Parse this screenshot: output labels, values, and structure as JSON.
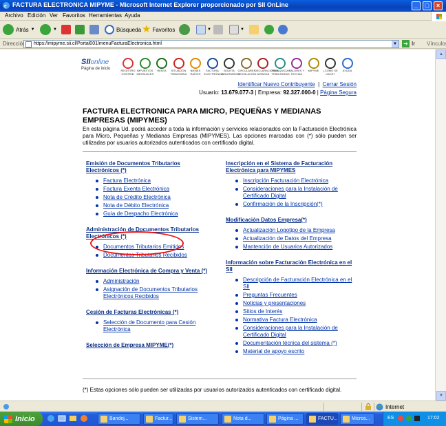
{
  "window": {
    "title": "FACTURA ELECTRONICA MIPYME - Microsoft Internet Explorer proporcionado por SII OnLine"
  },
  "menu": [
    "Archivo",
    "Edición",
    "Ver",
    "Favoritos",
    "Herramientas",
    "Ayuda"
  ],
  "toolbar": {
    "back": "Atrás",
    "search": "Búsqueda",
    "favorites": "Favoritos"
  },
  "address": {
    "label": "Dirección",
    "url": "https://mipyme.sii.cl/Portal001/menuFacturaElectronica.html",
    "go": "Ir",
    "links": "Vínculos"
  },
  "banner": {
    "logo_main": "SII",
    "logo_sub": "online",
    "logo_caption": "Página de inicio",
    "icons": [
      {
        "name": "registro-contribuyentes-icon",
        "label": "REGISTRO CONTRIB.",
        "color": "#d33"
      },
      {
        "name": "impuestos-mensuales-icon",
        "label": "IMPUESTOS MENSUALES",
        "color": "#2a8a2a"
      },
      {
        "name": "renta-icon",
        "label": "RENTA",
        "color": "#1a6a1a"
      },
      {
        "name": "situacion-tributaria-icon",
        "label": "SITUACIÓN TRIBUTARIA",
        "color": "#c22"
      },
      {
        "name": "bienes-raices-icon",
        "label": "BIENES RAÍCES",
        "color": "#e08a00"
      },
      {
        "name": "factura-electronica-icon",
        "label": "FACTURA ELECTRÓNICA",
        "color": "#1a4a9a"
      },
      {
        "name": "boleta-honorarios-icon",
        "label": "BOLETA HONORARIOS",
        "color": "#333"
      },
      {
        "name": "circulares-legislacion-icon",
        "label": "CIRCULARES LEGISLACIÓN",
        "color": "#8a6a2a"
      },
      {
        "name": "declaraciones-juradas-icon",
        "label": "DECLARACIONES JURADAS",
        "color": "#a22"
      },
      {
        "name": "franquicias-tributarias-icon",
        "label": "FRANQUICIAS TRIBUTARIAS",
        "color": "#2a8a8a"
      },
      {
        "name": "valores-y-fechas-icon",
        "label": "VALORES Y FECHAS",
        "color": "#9a2aa0"
      },
      {
        "name": "mipyme-icon",
        "label": "MIPYME",
        "color": "#b08a00"
      },
      {
        "name": "como-se-hace-icon",
        "label": "¿CÓMO SE HACE?",
        "color": "#333"
      },
      {
        "name": "ayuda-icon",
        "label": "AYUDA",
        "color": "#2a6ad0"
      }
    ]
  },
  "toplinks": {
    "identify": "Identificar Nuevo Contribuyente",
    "logout": "Cerrar Sesión",
    "usuario_label": "Usuario:",
    "usuario": "13.679.077-3",
    "empresa_label": "| Empresa:",
    "empresa": "92.327.000-0",
    "secure": "Página Segura"
  },
  "page": {
    "title": "FACTURA ELECTRONICA PARA MICRO, PEQUEÑAS Y MEDIANAS EMPRESAS (MIPYMES)",
    "intro": "En esta página Ud. podrá acceder a toda la información y servicios relacionados con la Facturación Electrónica para Micro, Pequeñas y Medianas Empresas (MIPYMES). Las opciones marcadas con (*) sólo pueden ser utilizadas por usuarios autorizados autenticados con certificado digital.",
    "footnote": "(*) Estas opciones sólo pueden ser utilizadas por usuarios autorizados autenticados con certificado digital."
  },
  "left_sections": [
    {
      "title": "Emisión de Documentos Tributarios Electrónicos (*)",
      "items": [
        "Factura Electrónica",
        "Factura Exenta Electrónica",
        "Nota de Crédito Electrónica",
        "Nota de Débito Electrónica",
        "Guía de Despacho Electrónica"
      ]
    },
    {
      "title": "Administración de Documentos Tributarios Electrónicos (*)",
      "items": [
        "Documentos Tributarios Emitidos",
        "Documentos Tributarios Recibidos"
      ]
    },
    {
      "title": "Información Electrónica de Compra y Venta (*)",
      "items": [
        "Administración",
        "Asignación de Documentos Tributarios Electrónicos Recibidos"
      ]
    },
    {
      "title": "Cesión de Facturas Electrónicas (*)",
      "items": [
        "Selección de Documento para Cesión Electrónica"
      ]
    },
    {
      "title": "Selección de Empresa MIPYME(*)",
      "items": []
    }
  ],
  "right_sections": [
    {
      "title": "Inscripción en el Sistema de Facturación Electrónica para MIPYMES",
      "items": [
        "Inscripción Facturación Electrónica",
        "Consideraciones para la Instalación de Certificado Digital",
        "Confirmación de la Inscripción(*)"
      ]
    },
    {
      "title": "Modificación Datos Empresa(*)",
      "items": [
        "Actualización Logotipo de la Empresa",
        "Actualización de Datos del Empresa",
        "Mantención de Usuarios Autorizados"
      ]
    },
    {
      "title": "Información sobre Facturación Electrónica en el SII",
      "items": [
        "Descripción de Facturación Electrónica en el SII",
        "Preguntas Frecuentes",
        "Noticias y presentaciones",
        "Sitios de Interés",
        "Normativa Factura Electrónica",
        "Consideraciones para la Instalación de Certificado Digital",
        "Documentación técnica del sistema (*)",
        "Material de apoyo escrito"
      ]
    }
  ],
  "status": {
    "zone": "Internet"
  },
  "taskbar": {
    "start": "Inicio",
    "tasks": [
      "Bandej...",
      "Factur...",
      "Sistem...",
      "Nota d...",
      "Página ...",
      "FACTU...",
      "Micros..."
    ],
    "lang": "ES",
    "clock": "17:02"
  },
  "colors": {
    "link": "#0033aa",
    "highlight_circle": "#e11111"
  }
}
